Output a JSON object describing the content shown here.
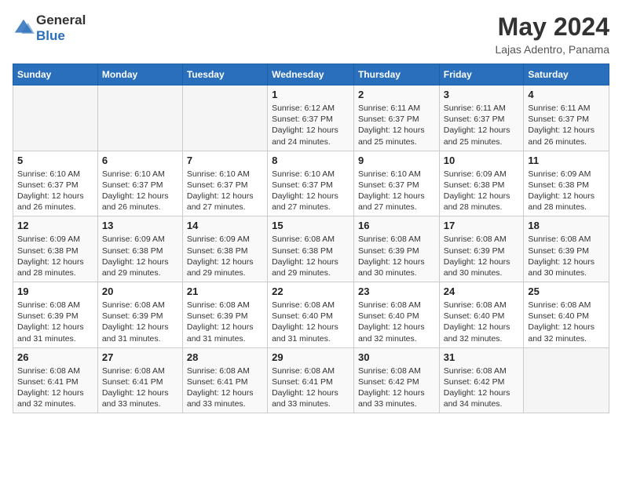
{
  "header": {
    "logo_line1": "General",
    "logo_line2": "Blue",
    "month_title": "May 2024",
    "location": "Lajas Adentro, Panama"
  },
  "days_of_week": [
    "Sunday",
    "Monday",
    "Tuesday",
    "Wednesday",
    "Thursday",
    "Friday",
    "Saturday"
  ],
  "weeks": [
    [
      {
        "day": "",
        "info": ""
      },
      {
        "day": "",
        "info": ""
      },
      {
        "day": "",
        "info": ""
      },
      {
        "day": "1",
        "info": "Sunrise: 6:12 AM\nSunset: 6:37 PM\nDaylight: 12 hours and 24 minutes."
      },
      {
        "day": "2",
        "info": "Sunrise: 6:11 AM\nSunset: 6:37 PM\nDaylight: 12 hours and 25 minutes."
      },
      {
        "day": "3",
        "info": "Sunrise: 6:11 AM\nSunset: 6:37 PM\nDaylight: 12 hours and 25 minutes."
      },
      {
        "day": "4",
        "info": "Sunrise: 6:11 AM\nSunset: 6:37 PM\nDaylight: 12 hours and 26 minutes."
      }
    ],
    [
      {
        "day": "5",
        "info": "Sunrise: 6:10 AM\nSunset: 6:37 PM\nDaylight: 12 hours and 26 minutes."
      },
      {
        "day": "6",
        "info": "Sunrise: 6:10 AM\nSunset: 6:37 PM\nDaylight: 12 hours and 26 minutes."
      },
      {
        "day": "7",
        "info": "Sunrise: 6:10 AM\nSunset: 6:37 PM\nDaylight: 12 hours and 27 minutes."
      },
      {
        "day": "8",
        "info": "Sunrise: 6:10 AM\nSunset: 6:37 PM\nDaylight: 12 hours and 27 minutes."
      },
      {
        "day": "9",
        "info": "Sunrise: 6:10 AM\nSunset: 6:37 PM\nDaylight: 12 hours and 27 minutes."
      },
      {
        "day": "10",
        "info": "Sunrise: 6:09 AM\nSunset: 6:38 PM\nDaylight: 12 hours and 28 minutes."
      },
      {
        "day": "11",
        "info": "Sunrise: 6:09 AM\nSunset: 6:38 PM\nDaylight: 12 hours and 28 minutes."
      }
    ],
    [
      {
        "day": "12",
        "info": "Sunrise: 6:09 AM\nSunset: 6:38 PM\nDaylight: 12 hours and 28 minutes."
      },
      {
        "day": "13",
        "info": "Sunrise: 6:09 AM\nSunset: 6:38 PM\nDaylight: 12 hours and 29 minutes."
      },
      {
        "day": "14",
        "info": "Sunrise: 6:09 AM\nSunset: 6:38 PM\nDaylight: 12 hours and 29 minutes."
      },
      {
        "day": "15",
        "info": "Sunrise: 6:08 AM\nSunset: 6:38 PM\nDaylight: 12 hours and 29 minutes."
      },
      {
        "day": "16",
        "info": "Sunrise: 6:08 AM\nSunset: 6:39 PM\nDaylight: 12 hours and 30 minutes."
      },
      {
        "day": "17",
        "info": "Sunrise: 6:08 AM\nSunset: 6:39 PM\nDaylight: 12 hours and 30 minutes."
      },
      {
        "day": "18",
        "info": "Sunrise: 6:08 AM\nSunset: 6:39 PM\nDaylight: 12 hours and 30 minutes."
      }
    ],
    [
      {
        "day": "19",
        "info": "Sunrise: 6:08 AM\nSunset: 6:39 PM\nDaylight: 12 hours and 31 minutes."
      },
      {
        "day": "20",
        "info": "Sunrise: 6:08 AM\nSunset: 6:39 PM\nDaylight: 12 hours and 31 minutes."
      },
      {
        "day": "21",
        "info": "Sunrise: 6:08 AM\nSunset: 6:39 PM\nDaylight: 12 hours and 31 minutes."
      },
      {
        "day": "22",
        "info": "Sunrise: 6:08 AM\nSunset: 6:40 PM\nDaylight: 12 hours and 31 minutes."
      },
      {
        "day": "23",
        "info": "Sunrise: 6:08 AM\nSunset: 6:40 PM\nDaylight: 12 hours and 32 minutes."
      },
      {
        "day": "24",
        "info": "Sunrise: 6:08 AM\nSunset: 6:40 PM\nDaylight: 12 hours and 32 minutes."
      },
      {
        "day": "25",
        "info": "Sunrise: 6:08 AM\nSunset: 6:40 PM\nDaylight: 12 hours and 32 minutes."
      }
    ],
    [
      {
        "day": "26",
        "info": "Sunrise: 6:08 AM\nSunset: 6:41 PM\nDaylight: 12 hours and 32 minutes."
      },
      {
        "day": "27",
        "info": "Sunrise: 6:08 AM\nSunset: 6:41 PM\nDaylight: 12 hours and 33 minutes."
      },
      {
        "day": "28",
        "info": "Sunrise: 6:08 AM\nSunset: 6:41 PM\nDaylight: 12 hours and 33 minutes."
      },
      {
        "day": "29",
        "info": "Sunrise: 6:08 AM\nSunset: 6:41 PM\nDaylight: 12 hours and 33 minutes."
      },
      {
        "day": "30",
        "info": "Sunrise: 6:08 AM\nSunset: 6:42 PM\nDaylight: 12 hours and 33 minutes."
      },
      {
        "day": "31",
        "info": "Sunrise: 6:08 AM\nSunset: 6:42 PM\nDaylight: 12 hours and 34 minutes."
      },
      {
        "day": "",
        "info": ""
      }
    ]
  ]
}
